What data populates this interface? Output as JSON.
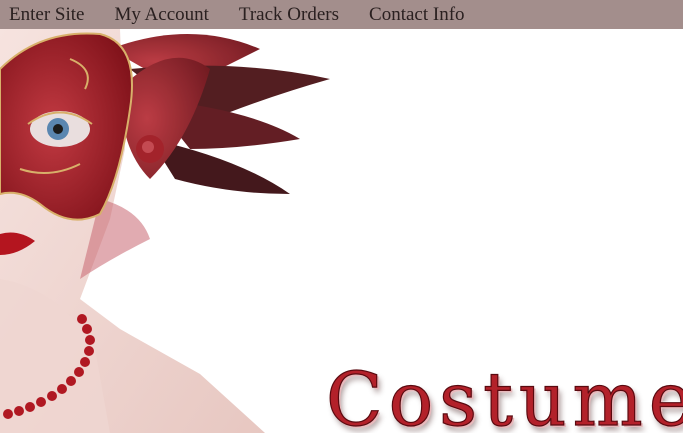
{
  "nav": {
    "items": [
      {
        "label": "Enter Site"
      },
      {
        "label": "My Account"
      },
      {
        "label": "Track Orders"
      },
      {
        "label": "Contact Info"
      }
    ]
  },
  "hero": {
    "image": "woman-in-red-masquerade-mask-with-feathers",
    "brand_text": "Costume"
  },
  "colors": {
    "nav_bar": "#a38e8c",
    "accent_red": "#b3212a"
  }
}
